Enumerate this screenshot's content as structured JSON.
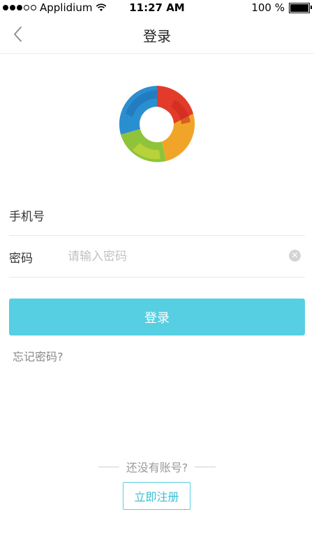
{
  "status_bar": {
    "carrier": "Applidium",
    "time": "11:27 AM",
    "battery_text": "100 %",
    "icons": [
      "signal-dots-icon",
      "wifi-icon",
      "battery-icon"
    ]
  },
  "nav": {
    "title": "登录",
    "back_icon": "chevron-left-icon"
  },
  "logo": {
    "icon": "app-logo-ring"
  },
  "form": {
    "phone_label": "手机号",
    "phone_placeholder": "",
    "password_label": "密码",
    "password_placeholder": "请输入密码",
    "clear_icon": "clear-icon"
  },
  "actions": {
    "login_label": "登录",
    "forgot_label": "忘记密码?",
    "no_account_text": "还没有账号?",
    "register_label": "立即注册"
  },
  "colors": {
    "accent": "#56cfe2",
    "border": "#e8e8e8",
    "muted_text": "#999999"
  }
}
